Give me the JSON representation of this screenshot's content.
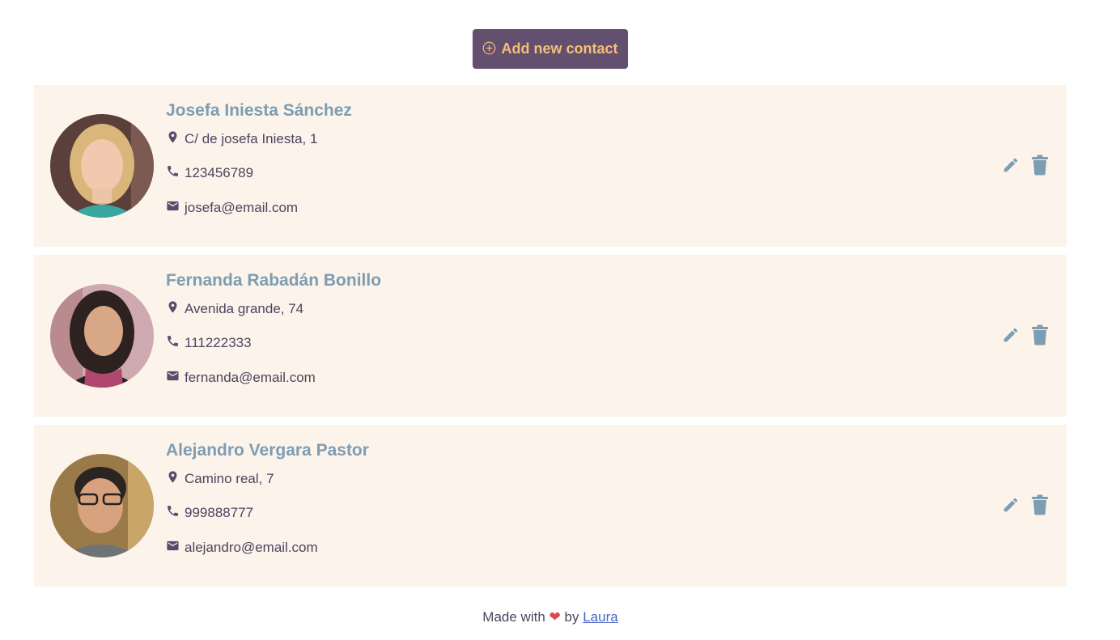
{
  "toolbar": {
    "add_label": "Add new contact"
  },
  "contacts": [
    {
      "name": "Josefa Iniesta Sánchez",
      "address": "C/ de josefa Iniesta, 1",
      "phone": "123456789",
      "email": "josefa@email.com"
    },
    {
      "name": "Fernanda Rabadán Bonillo",
      "address": "Avenida grande, 74",
      "phone": "111222333",
      "email": "fernanda@email.com"
    },
    {
      "name": "Alejandro Vergara Pastor",
      "address": "Camino real, 7",
      "phone": "999888777",
      "email": "alejandro@email.com"
    }
  ],
  "footer": {
    "made_with": "Made with",
    "by": "by",
    "author": "Laura"
  },
  "icons": {
    "add": "plus-circle-icon",
    "location": "map-pin-icon",
    "phone": "phone-icon",
    "email": "envelope-icon",
    "edit": "pencil-icon",
    "delete": "trash-icon",
    "heart": "heart-icon"
  },
  "colors": {
    "button_bg": "#634f6e",
    "button_text": "#f6be78",
    "card_bg": "#fcf3ea",
    "name": "#7d9db3",
    "text": "#4b4560",
    "action": "#7d9db3",
    "heart": "#e0464e",
    "link": "#4a63c6"
  }
}
